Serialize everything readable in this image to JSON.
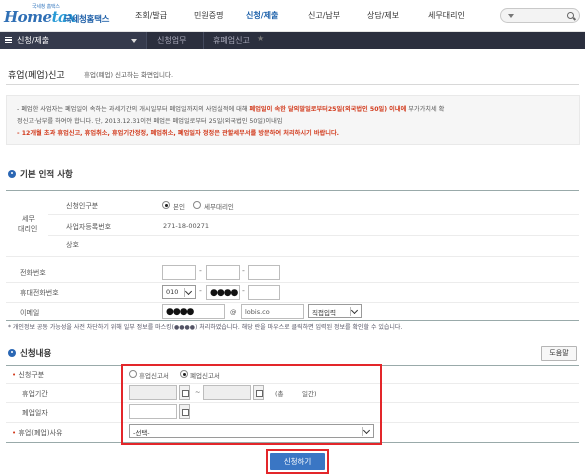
{
  "header": {
    "logo_small": "국세청 홈택스",
    "logo_home": "Home",
    "logo_tax": "tax",
    "logo_kr": "국세청홈택스",
    "menu": [
      "조회/발급",
      "민원증명",
      "신청/제출",
      "신고/납부",
      "상담/제보",
      "세무대리인"
    ]
  },
  "navbar": {
    "menu1": "신청/제출",
    "menu2": "신청업무",
    "menu3": "휴폐업신고"
  },
  "page": {
    "title": "휴업(폐업)신고",
    "description": "휴업(폐업) 신고하는 화면입니다."
  },
  "notice": {
    "line1_a": "- 폐업한 사업자는 폐업일이 속하는 과세기간의 개시일부터 폐업일까지의 사업실적에 대해 ",
    "line1_red": "폐업일이 속한 달의말일로부터25일(외국법인 50일) 이내에",
    "line1_b": " 부가가치세 확",
    "line2": "  정신고·납부를 하여야 합니다. 단, 2013.12.31이전 폐업은 폐업일로부터 25일(외국법인 50일)이내임",
    "line3_red": "- 12개월 초과 휴업신고, 휴업취소, 휴업기간정정, 폐업취소, 폐업일자 정정은 관할세무서를 방문하여 처리하시기 바랍니다."
  },
  "basic": {
    "section_title": "기본 인적 사항",
    "agent_label_1": "세무",
    "agent_label_2": "대리인",
    "applicant_type_label": "신청인구분",
    "applicant_self": "본인",
    "applicant_agent": "세무대리인",
    "bizno_label": "사업자등록번호",
    "bizno_value": "271-18-00271",
    "company_label": "상호",
    "phone_label": "전화번호",
    "mobile_label": "휴대전화번호",
    "mobile_prefix": "010",
    "mobile_mid": "●●●●",
    "email_label": "이메일",
    "email_id": "●●●●",
    "email_at": "@",
    "email_domain": "lobis.co",
    "email_direct": "직접입력",
    "hint": "* 개인정보 공동 가능성을 사전 차단하기 위해 일부 정보를 마스킹(●●●●) 처리하였습니다. 해당 란을 마우스로 클릭하면 입력된 정보를 확인할 수 있습니다."
  },
  "apply": {
    "section_title": "신청내용",
    "help_button": "도움말",
    "type_label": "신청구분",
    "type_option1": "휴업신고서",
    "type_option2": "폐업신고서",
    "period_label": "휴업기간",
    "period_tilde": "~",
    "period_days_open": "(총",
    "period_days_close": "일간)",
    "closing_date_label": "폐업일자",
    "reason_label": "휴업(폐업)사유",
    "reason_selected": "-선택-",
    "submit_button": "신청하기"
  }
}
